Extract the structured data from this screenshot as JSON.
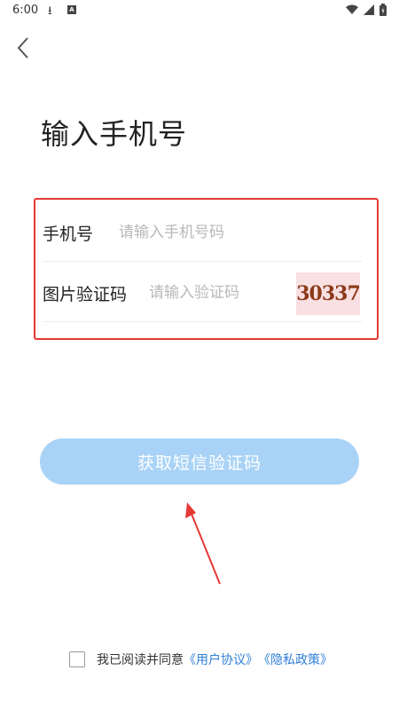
{
  "status_bar": {
    "time": "6:00",
    "letter_badge": "A"
  },
  "page": {
    "title": "输入手机号"
  },
  "form": {
    "phone_label": "手机号",
    "phone_placeholder": "请输入手机号码",
    "captcha_label": "图片验证码",
    "captcha_placeholder": "请输入验证码",
    "captcha_text": "30337"
  },
  "submit": {
    "label": "获取短信验证码"
  },
  "agreement": {
    "prefix": "我已阅读并同意",
    "user_agreement": "《用户协议》",
    "privacy_policy": "《隐私政策》"
  },
  "colors": {
    "accent_button": "#a9d3f6",
    "link": "#2f7fd8",
    "highlight_border": "#e53935"
  }
}
